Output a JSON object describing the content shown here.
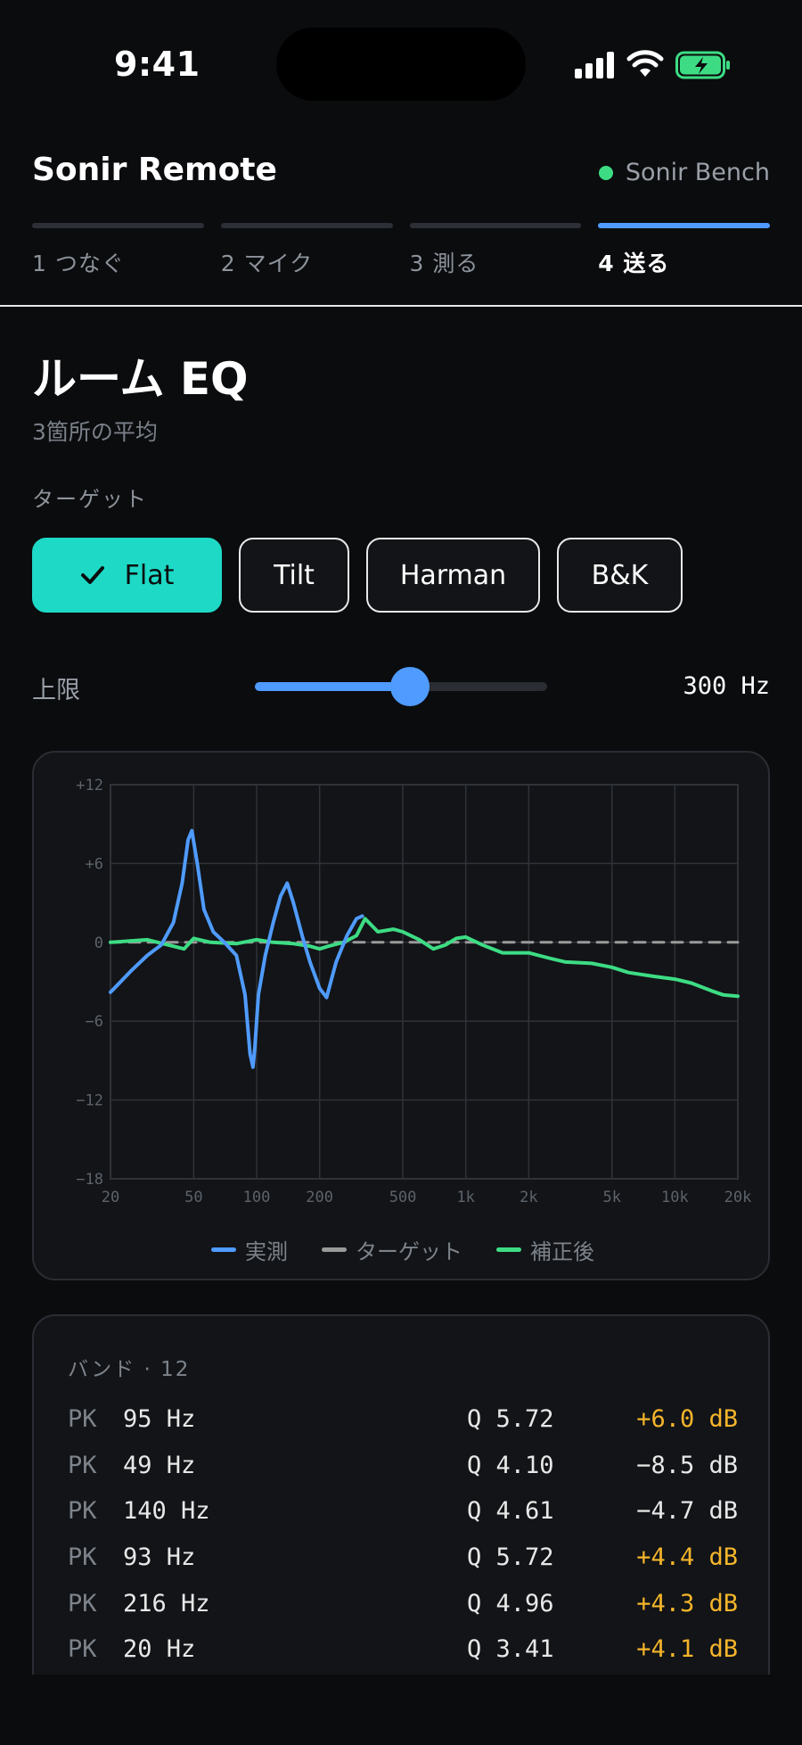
{
  "status_bar": {
    "time": "9:41"
  },
  "header": {
    "app_title": "Sonir Remote",
    "device_name": "Sonir Bench",
    "device_status_color": "#3ddc84"
  },
  "steps": [
    {
      "label": "1  つなぐ",
      "active": false
    },
    {
      "label": "2  マイク",
      "active": false
    },
    {
      "label": "3  測る",
      "active": false
    },
    {
      "label": "4  送る",
      "active": true
    }
  ],
  "page": {
    "title": "ルーム EQ",
    "subtitle": "3箇所の平均",
    "target_label": "ターゲット"
  },
  "targets": [
    {
      "label": "Flat",
      "selected": true
    },
    {
      "label": "Tilt",
      "selected": false
    },
    {
      "label": "Harman",
      "selected": false
    },
    {
      "label": "B&K",
      "selected": false
    }
  ],
  "limit": {
    "label": "上限",
    "value_text": "300 Hz",
    "slider_fraction": 0.53
  },
  "colors": {
    "accent": "#4f9bff",
    "selected_chip": "#1ed9c6",
    "measured": "#4f9bff",
    "target": "#9a9a9a",
    "corrected": "#3ddc84",
    "positive_gain": "#f5b52b"
  },
  "chart_data": {
    "type": "line",
    "x_scale": "log",
    "xlim": [
      20,
      20000
    ],
    "ylim": [
      -18,
      12
    ],
    "x_ticks": [
      20,
      50,
      100,
      200,
      500,
      1000,
      2000,
      5000,
      10000,
      20000
    ],
    "x_tick_labels": [
      "20",
      "50",
      "100",
      "200",
      "500",
      "1k",
      "2k",
      "5k",
      "10k",
      "20k"
    ],
    "y_ticks": [
      12,
      6,
      0,
      -6,
      -12,
      -18
    ],
    "y_tick_labels": [
      "+12",
      "+6",
      "0",
      "−6",
      "−12",
      "−18"
    ],
    "grid": true,
    "legend_position": "bottom",
    "series": [
      {
        "name": "実測",
        "x": [
          20,
          25,
          30,
          35,
          40,
          44,
          47,
          49,
          52,
          56,
          62,
          70,
          80,
          88,
          93,
          96,
          98,
          102,
          110,
          120,
          130,
          140,
          150,
          165,
          180,
          200,
          216,
          240,
          270,
          300,
          320
        ],
        "y": [
          -3.8,
          -2.2,
          -1.0,
          -0.2,
          1.5,
          4.5,
          7.8,
          8.5,
          6.0,
          2.5,
          0.8,
          0.0,
          -1.0,
          -4.0,
          -8.5,
          -9.5,
          -8.0,
          -4.0,
          -1.0,
          1.5,
          3.5,
          4.5,
          3.0,
          0.5,
          -1.5,
          -3.5,
          -4.2,
          -1.5,
          0.5,
          1.8,
          2.0
        ]
      },
      {
        "name": "ターゲット",
        "x": [
          20,
          20000
        ],
        "y": [
          0,
          0
        ]
      },
      {
        "name": "補正後",
        "x": [
          20,
          30,
          40,
          45,
          50,
          60,
          80,
          100,
          120,
          150,
          180,
          200,
          220,
          260,
          300,
          330,
          380,
          450,
          500,
          600,
          700,
          800,
          900,
          1000,
          1200,
          1500,
          2000,
          2500,
          3000,
          4000,
          5000,
          6000,
          8000,
          10000,
          12000,
          15000,
          17000,
          20000
        ],
        "y": [
          0,
          0.2,
          -0.3,
          -0.5,
          0.3,
          0,
          -0.1,
          0.2,
          0,
          -0.1,
          -0.3,
          -0.5,
          -0.3,
          0,
          0.5,
          1.8,
          0.8,
          1.0,
          0.8,
          0.2,
          -0.5,
          -0.2,
          0.3,
          0.4,
          -0.2,
          -0.8,
          -0.8,
          -1.2,
          -1.5,
          -1.6,
          -1.9,
          -2.3,
          -2.6,
          -2.8,
          -3.1,
          -3.7,
          -4.0,
          -4.1
        ]
      }
    ]
  },
  "legend": [
    {
      "label": "実測",
      "color": "#4f9bff"
    },
    {
      "label": "ターゲット",
      "color": "#9a9a9a"
    },
    {
      "label": "補正後",
      "color": "#3ddc84"
    }
  ],
  "bands": {
    "header": "バンド · 12",
    "rows": [
      {
        "type": "PK",
        "freq": "95 Hz",
        "q": "Q 5.72",
        "gain": "+6.0 dB",
        "positive": true
      },
      {
        "type": "PK",
        "freq": "49 Hz",
        "q": "Q 4.10",
        "gain": "−8.5 dB",
        "positive": false
      },
      {
        "type": "PK",
        "freq": "140 Hz",
        "q": "Q 4.61",
        "gain": "−4.7 dB",
        "positive": false
      },
      {
        "type": "PK",
        "freq": "93 Hz",
        "q": "Q 5.72",
        "gain": "+4.4 dB",
        "positive": true
      },
      {
        "type": "PK",
        "freq": "216 Hz",
        "q": "Q 4.96",
        "gain": "+4.3 dB",
        "positive": true
      },
      {
        "type": "PK",
        "freq": "20 Hz",
        "q": "Q 3.41",
        "gain": "+4.1 dB",
        "positive": true
      }
    ]
  }
}
